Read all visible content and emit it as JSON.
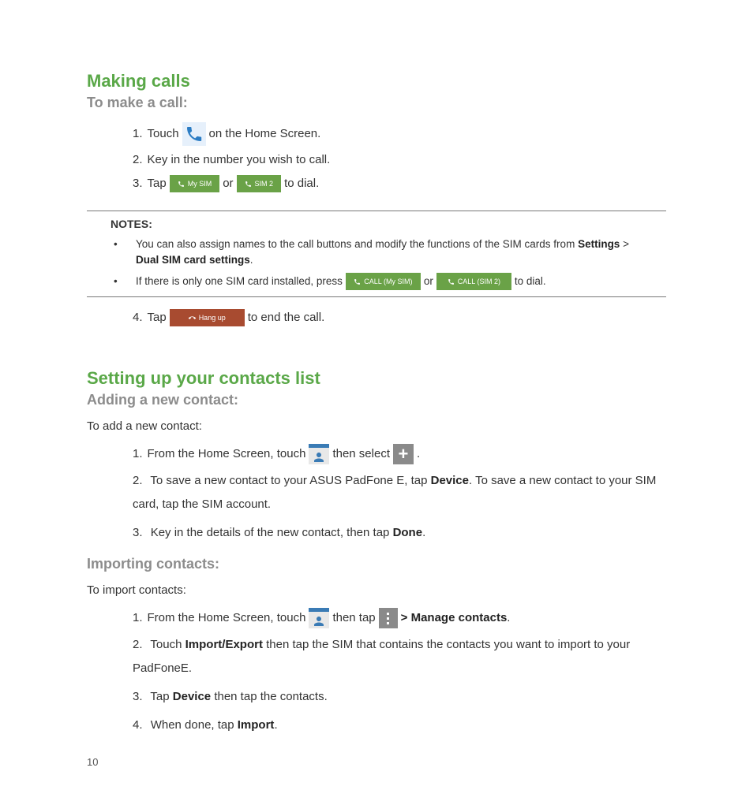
{
  "page_number": "10",
  "making_calls": {
    "heading": "Making calls",
    "subheading": "To make a call:",
    "step1_pre": "Touch",
    "step1_post": " on the Home Screen.",
    "step2": "Key in the number you wish to call.",
    "step3_pre": " Tap ",
    "step3_mid": " or ",
    "step3_post": " to dial.",
    "btn_mysim": "My SIM",
    "btn_sim2": "SIM 2",
    "step4_pre": " Tap ",
    "step4_post": " to end the call.",
    "btn_hangup": "Hang up"
  },
  "notes": {
    "title": "NOTES:",
    "n1_pre": "You can also assign names to the call buttons and modify the functions of the SIM cards from ",
    "n1_b1": "Settings",
    "n1_mid": " > ",
    "n1_b2": "Dual SIM card settings",
    "n1_post": ".",
    "n2_pre": "If there is only one SIM card installed, press ",
    "n2_mid": " or ",
    "n2_post": " to dial.",
    "btn_call_mysim": "CALL (My SIM)",
    "btn_call_sim2": "CALL (SIM 2)"
  },
  "contacts": {
    "heading": "Setting up your contacts list",
    "adding_sub": "Adding a new contact:",
    "adding_intro": "To add a new contact:",
    "a1_pre": " From the Home Screen, touch ",
    "a1_mid": " then select ",
    "a1_post": ".",
    "a2_pre": " To save a new contact to your ASUS PadFone E, tap ",
    "a2_b1": "Device",
    "a2_mid": ". To save a new contact to your SIM card, tap the SIM account.",
    "a3_pre": " Key in the details of the new contact, then tap ",
    "a3_b1": "Done",
    "a3_post": ".",
    "import_sub": "Importing contacts:",
    "import_intro": "To import contacts:",
    "i1_pre": " From the Home Screen, touch ",
    "i1_mid": " then tap ",
    "i1_b": " > Manage contacts",
    "i1_post": ".",
    "i2_pre": " Touch ",
    "i2_b1": "Import/Export",
    "i2_mid": " then tap the SIM that contains the contacts you want to import to your PadFoneE.",
    "i3_pre": " Tap ",
    "i3_b1": "Device",
    "i3_mid": " then tap the contacts.",
    "i4_pre": " When done, tap ",
    "i4_b1": "Import",
    "i4_post": "."
  }
}
